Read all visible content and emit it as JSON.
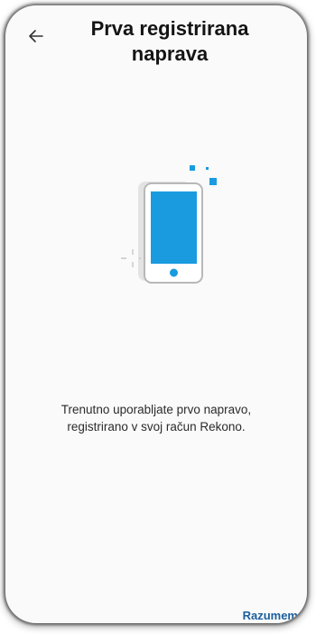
{
  "header": {
    "back_icon": "arrow-left-icon",
    "title_line1": "Prva registrirana",
    "title_line2": "naprava"
  },
  "illustration": {
    "icon": "smartphone-icon",
    "accent_color": "#1a9be0"
  },
  "message": {
    "line1": "Trenutno uporabljate prvo napravo,",
    "line2": "registrirano v svoj račun Rekono."
  },
  "actions": {
    "confirm_label": "Razumem",
    "confirm_color": "#1a5f9e"
  }
}
